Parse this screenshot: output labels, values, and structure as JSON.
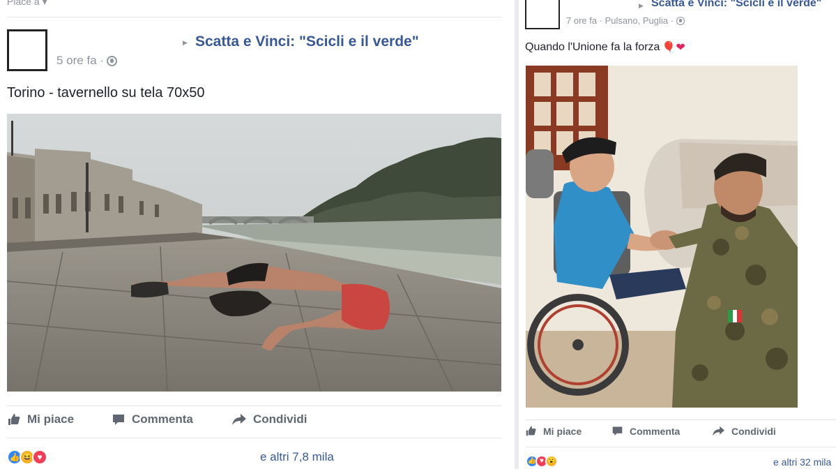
{
  "posts": [
    {
      "header_partial": "Piace a",
      "page_name": "Scatta e Vinci: \"Scicli e il verde\"",
      "time": "5 ore fa ·",
      "location": "",
      "caption": "Torino - tavernello su tela 70x50",
      "photo_icon": "photo-riverside-man-lying",
      "actions": {
        "like": "Mi piace",
        "comment": "Commenta",
        "share": "Condividi"
      },
      "reactions": [
        "like",
        "haha",
        "love"
      ],
      "reaction_count": "e altri 7,8 mila"
    },
    {
      "page_name": "Scatta e Vinci: \"Scicli e il verde\"",
      "time": "7 ore fa · Pulsano, Puglia ·",
      "caption": "Quando l'Unione fa la forza",
      "caption_emoji": "🎈❤",
      "photo_icon": "photo-soldier-wheelchair-handshake",
      "actions": {
        "like": "Mi piace",
        "comment": "Commenta",
        "share": "Condividi"
      },
      "reactions": [
        "like",
        "love",
        "wow"
      ],
      "reaction_count": "e altri 32 mila"
    }
  ],
  "colors": {
    "link": "#365899",
    "meta": "#90949c",
    "action": "#606770",
    "like": "#2d88ff",
    "love": "#f33e58",
    "haha": "#f7b125"
  }
}
